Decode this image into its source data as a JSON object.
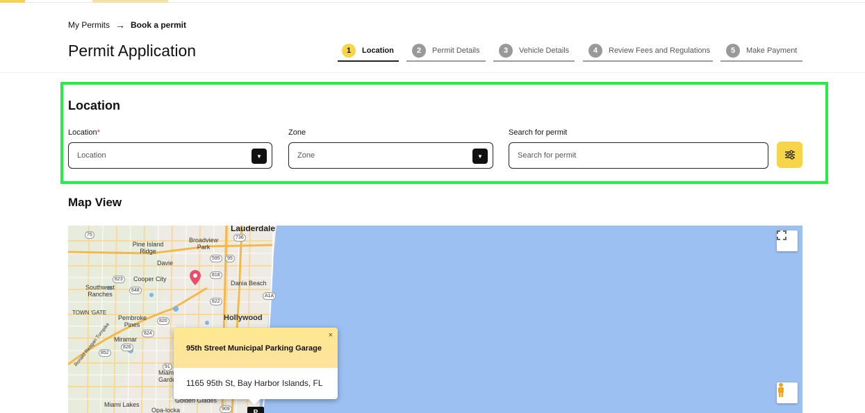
{
  "breadcrumb": {
    "parent": "My Permits",
    "separator": "→",
    "current": "Book a permit"
  },
  "page": {
    "title": "Permit Application"
  },
  "steps": [
    {
      "num": "1",
      "label": "Location",
      "active": true
    },
    {
      "num": "2",
      "label": "Permit Details",
      "active": false
    },
    {
      "num": "3",
      "label": "Vehicle Details",
      "active": false
    },
    {
      "num": "4",
      "label": "Review Fees and Regulations",
      "active": false
    },
    {
      "num": "5",
      "label": "Make Payment",
      "active": false
    }
  ],
  "location_section": {
    "title": "Location",
    "location_field": {
      "label": "Location",
      "required_mark": "*",
      "placeholder": "Location"
    },
    "zone_field": {
      "label": "Zone",
      "placeholder": "Zone"
    },
    "search_field": {
      "label": "Search for permit",
      "placeholder": "Search for permit"
    },
    "filter_icon": "sliders-icon"
  },
  "map_section": {
    "title": "Map View",
    "place_labels": [
      "Lauderdale",
      "Broadview Park",
      "Pine Island Ridge",
      "Davie",
      "Cooper City",
      "Dania Beach",
      "Southwest Ranches",
      "Hollywood",
      "TOWN 'GATE",
      "Pembroke Pines",
      "Miramar",
      "Miami Gardens",
      "Miami Lakes",
      "Golden Glades",
      "Opa-locka",
      "Ronald Reagan Turnpike"
    ],
    "road_shields": [
      "75",
      "736",
      "595",
      "95",
      "818",
      "823",
      "848",
      "822",
      "A1A",
      "820",
      "824",
      "826",
      "852",
      "909",
      "91"
    ],
    "info_window": {
      "name": "95th Street Municipal Parking Garage",
      "address": "1165 95th St, Bay Harbor Islands, FL",
      "close_label": "×"
    },
    "parking_marker": "P"
  },
  "colors": {
    "accent": "#f7d54a",
    "highlight_border": "#22ee44",
    "water": "#9cc0f2",
    "land": "#eeebe4",
    "pin": "#ea4e6e"
  }
}
